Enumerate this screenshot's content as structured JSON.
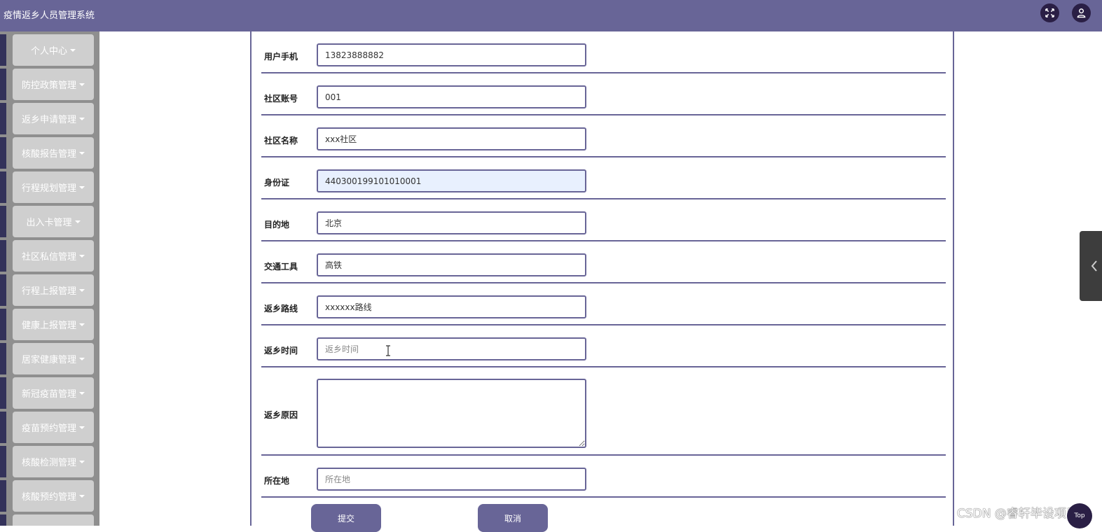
{
  "header": {
    "app_title": "疫情返乡人员管理系统",
    "fullscreen_icon": "fullscreen-icon",
    "user_icon": "user-icon"
  },
  "sidebar": {
    "items": [
      {
        "label": "个人中心"
      },
      {
        "label": "防控政策管理"
      },
      {
        "label": "返乡申请管理"
      },
      {
        "label": "核酸报告管理"
      },
      {
        "label": "行程规划管理"
      },
      {
        "label": "出入卡管理"
      },
      {
        "label": "社区私信管理"
      },
      {
        "label": "行程上报管理"
      },
      {
        "label": "健康上报管理"
      },
      {
        "label": "居家健康管理"
      },
      {
        "label": "新冠疫苗管理"
      },
      {
        "label": "疫苗预约管理"
      },
      {
        "label": "核酸检测管理"
      },
      {
        "label": "核酸预约管理"
      }
    ]
  },
  "form": {
    "fields": [
      {
        "label": "用户手机",
        "value": "13823888882",
        "placeholder": ""
      },
      {
        "label": "社区账号",
        "value": "001",
        "placeholder": ""
      },
      {
        "label": "社区名称",
        "value": "xxx社区",
        "placeholder": ""
      },
      {
        "label": "身份证",
        "value": "440300199101010001",
        "placeholder": ""
      },
      {
        "label": "目的地",
        "value": "北京",
        "placeholder": ""
      },
      {
        "label": "交通工具",
        "value": "高铁",
        "placeholder": ""
      },
      {
        "label": "返乡路线",
        "value": "xxxxxx路线",
        "placeholder": ""
      },
      {
        "label": "返乡时间",
        "value": "",
        "placeholder": "返乡时间"
      },
      {
        "label": "返乡原因",
        "value": "",
        "placeholder": ""
      },
      {
        "label": "所在地",
        "value": "",
        "placeholder": "所在地"
      }
    ],
    "submit_label": "提交",
    "cancel_label": "取消"
  },
  "watermark": "CSDN @睿轩毕设项目",
  "top_button_label": "Top",
  "colors": {
    "primary": "#686597",
    "dark": "#2a1f45",
    "sidebar_bg": "#8f8f8f",
    "menu_button": "#cfcfcf",
    "highlight_input": "#e8f0fe"
  }
}
